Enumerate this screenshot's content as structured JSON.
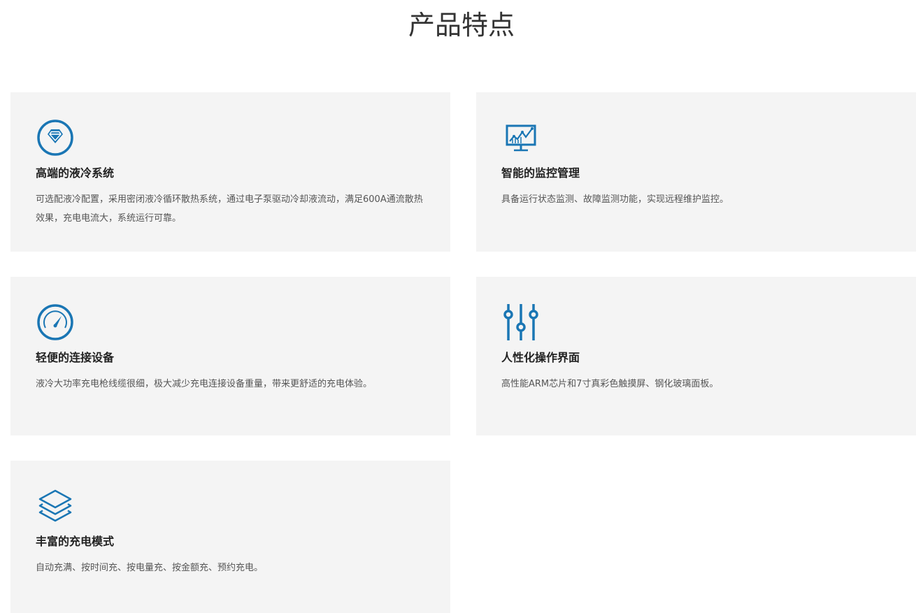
{
  "page": {
    "title": "产品特点"
  },
  "colors": {
    "accent": "#1a76b4",
    "card_bg": "#f4f4f4",
    "title_text": "#222222",
    "desc_text": "#555555"
  },
  "features": [
    {
      "icon": "diamond-icon",
      "title": "高端的液冷系统",
      "description": "可选配液冷配置，采用密闭液冷循环散热系统，通过电子泵驱动冷却液流动，满足600A通流散热效果，充电电流大，系统运行可靠。"
    },
    {
      "icon": "monitor-chart-icon",
      "title": "智能的监控管理",
      "description": "具备运行状态监测、故障监测功能，实现远程维护监控。"
    },
    {
      "icon": "speedometer-icon",
      "title": "轻便的连接设备",
      "description": "液冷大功率充电枪线缆很细，极大减少充电连接设备重量，带来更舒适的充电体验。"
    },
    {
      "icon": "sliders-icon",
      "title": "人性化操作界面",
      "description": "高性能ARM芯片和7寸真彩色触摸屏、钢化玻璃面板。"
    },
    {
      "icon": "layers-icon",
      "title": "丰富的充电模式",
      "description": "自动充满、按时间充、按电量充、按金额充、预约充电。"
    }
  ]
}
